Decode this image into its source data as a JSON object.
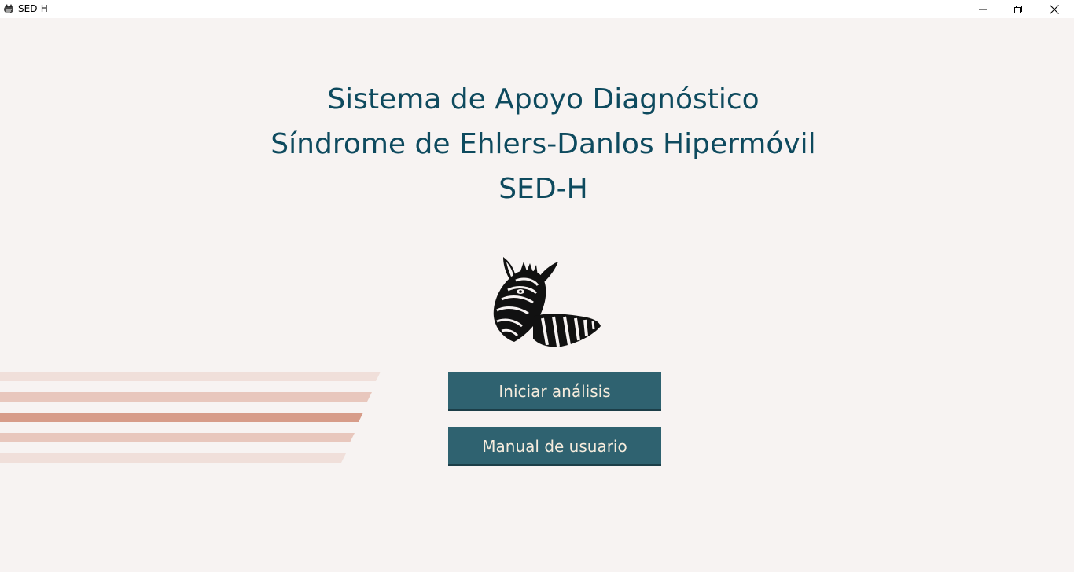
{
  "window": {
    "title": "SED-H",
    "controls": [
      "minimize-icon",
      "restore-icon",
      "close-icon"
    ]
  },
  "header": {
    "line1": "Sistema de Apoyo Diagnóstico",
    "line2": "Síndrome de Ehlers-Danlos Hipermóvil",
    "line3": "SED-H"
  },
  "logo": {
    "icon": "zebra-icon"
  },
  "buttons": {
    "start_label": "Iniciar análisis",
    "manual_label": "Manual de usuario"
  },
  "colors": {
    "background": "#f7f3f2",
    "heading": "#0e4a5e",
    "button_bg": "#2f6270",
    "button_text": "#f6ecdd",
    "stripe_light": "#f0dfda",
    "stripe_mid": "#e8c7bd",
    "stripe_dark": "#d79c89"
  }
}
